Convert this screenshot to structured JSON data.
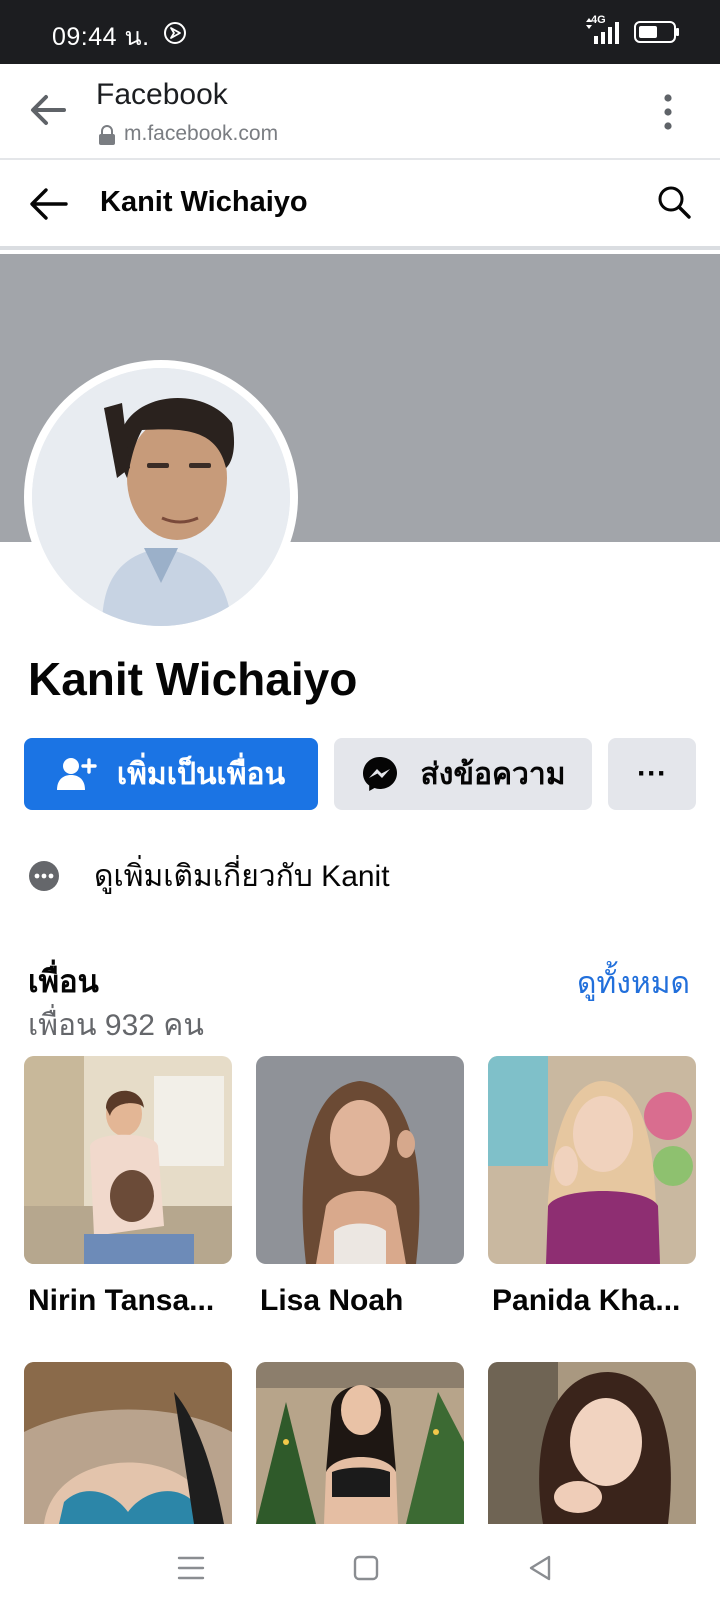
{
  "status_bar": {
    "time": "09:44 น.",
    "network": "4G"
  },
  "browser": {
    "site_title": "Facebook",
    "url": "m.facebook.com"
  },
  "header": {
    "title": "Kanit Wichaiyo"
  },
  "profile": {
    "name": "Kanit Wichaiyo",
    "add_friend_label": "เพิ่มเป็นเพื่อน",
    "message_label": "ส่งข้อความ",
    "more_label": "···",
    "see_more_about": "ดูเพิ่มเติมเกี่ยวกับ Kanit"
  },
  "friends": {
    "title": "เพื่อน",
    "count_text": "เพื่อน 932 คน",
    "see_all": "ดูทั้งหมด",
    "items": [
      {
        "name": "Nirin Tansa..."
      },
      {
        "name": "Lisa Noah"
      },
      {
        "name": "Panida Kha..."
      },
      {
        "name": ""
      },
      {
        "name": ""
      },
      {
        "name": ""
      }
    ]
  },
  "colors": {
    "accent": "#1b74e4",
    "link": "#216fdb",
    "cover": "#a2a5aa",
    "secondary_button": "#e4e6eb"
  },
  "icons": {
    "status": [
      "location-icon",
      "signal-icon",
      "battery-icon"
    ],
    "browser": [
      "back-icon",
      "lock-icon",
      "kebab-menu-icon"
    ],
    "header": [
      "back-arrow-icon",
      "search-icon"
    ],
    "nav": [
      "menu-icon",
      "home-square-icon",
      "back-triangle-icon"
    ]
  }
}
